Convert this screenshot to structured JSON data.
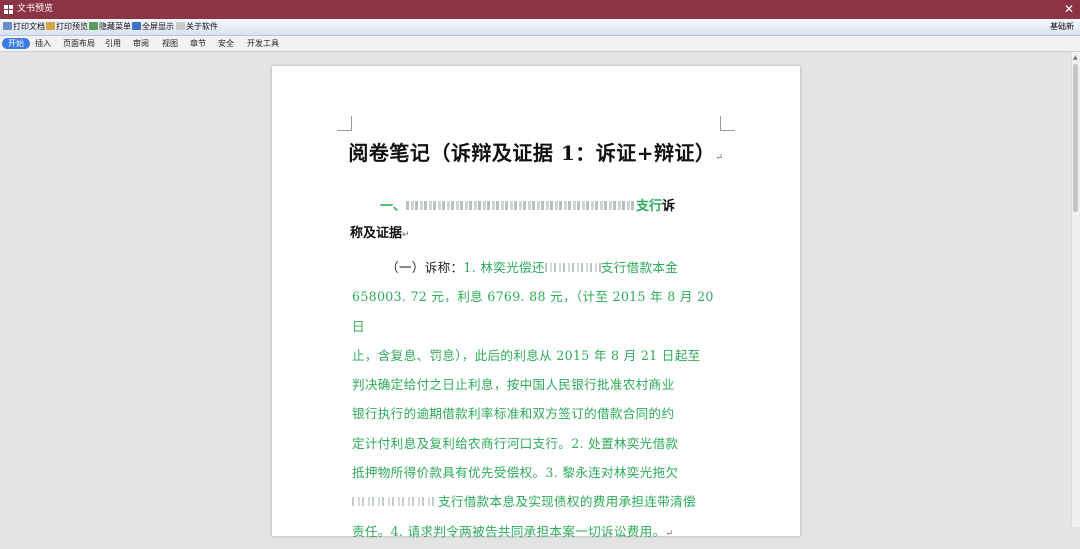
{
  "window": {
    "title": "文书预览",
    "close_glyph": "✕"
  },
  "toolbar": {
    "buttons": [
      {
        "label": "打印文档",
        "icon": "print-icon"
      },
      {
        "label": "打印预览",
        "icon": "print-preview-icon"
      },
      {
        "label": "隐藏菜单",
        "icon": "hide-menu-icon"
      },
      {
        "label": "全屏显示",
        "icon": "fullscreen-icon"
      },
      {
        "label": "关于软件",
        "icon": "about-icon"
      }
    ],
    "right_label": "基础新"
  },
  "tabs": [
    "开始",
    "插入",
    "页面布局",
    "引用",
    "审阅",
    "视图",
    "章节",
    "安全",
    "开发工具"
  ],
  "active_tab": "开始",
  "document": {
    "title": "阅卷笔记（诉辩及证据 1：诉证+辩证）",
    "section_prefix": "一、",
    "section_green": "支行",
    "section_tail": "诉",
    "section_line2": "称及证据",
    "claim_label": "（一）诉称：",
    "claim_l1": "1. 林奕光偿还",
    "claim_l1b": "支行借款本金",
    "claim_lines": [
      "658003. 72 元，利息 6769. 88 元，（计至 2015 年 8 月 20 日",
      "止，含复息、罚息），此后的利息从 2015 年 8 月 21 日起至",
      "判决确定给付之日止利息，按中国人民银行批准农村商业",
      "银行执行的逾期借款利率标准和双方签订的借款合同的约",
      "定计付利息及复利给农商行河口支行。2. 处置林奕光借款",
      "抵押物所得价款具有优先受偿权。3. 黎永连对林奕光拖欠"
    ],
    "claim_l8": "支行借款本息及实现债权的费用承担连带清偿",
    "claim_l9": "责任。4. 请求判令两被告共同承担本案一切诉讼费用。"
  },
  "colors": {
    "titlebar": "#8c3344",
    "accent_green": "#2eab5a",
    "active_tab": "#3b7ce0"
  }
}
